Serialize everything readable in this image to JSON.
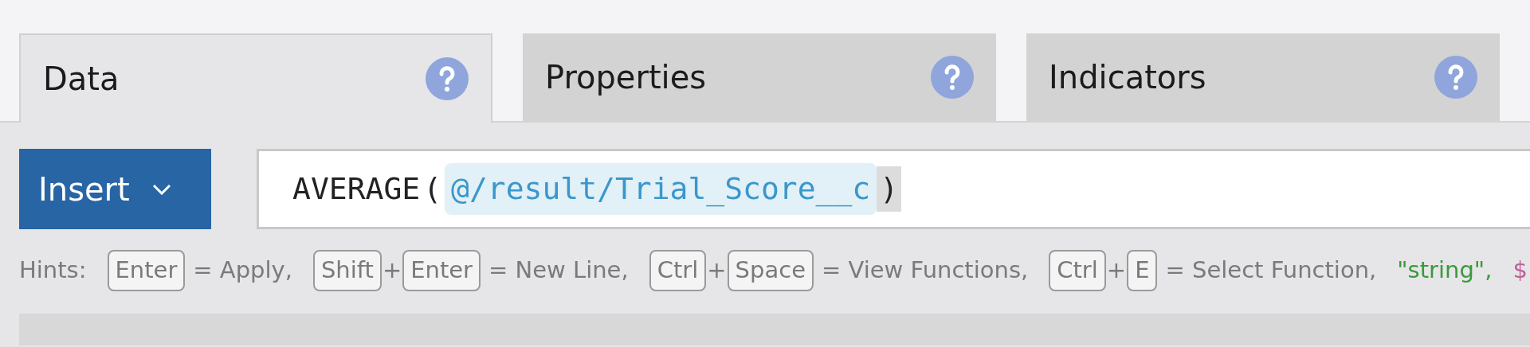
{
  "tabs": [
    {
      "label": "Data",
      "selected": true
    },
    {
      "label": "Properties",
      "selected": false
    },
    {
      "label": "Indicators",
      "selected": false
    }
  ],
  "insert_button": {
    "label": "Insert"
  },
  "expression": [
    {
      "kind": "function",
      "text": "AVERAGE"
    },
    {
      "kind": "paren",
      "text": "("
    },
    {
      "kind": "field",
      "text": "@/result/Trial_Score__c"
    },
    {
      "kind": "paren",
      "text": ")",
      "matched": true
    }
  ],
  "hints": {
    "label": "Hints:",
    "parts": [
      {
        "kind": "key",
        "text": "Enter"
      },
      {
        "kind": "text",
        "text": "= Apply,"
      },
      {
        "kind": "key",
        "text": "Shift"
      },
      {
        "kind": "plus",
        "text": "+"
      },
      {
        "kind": "key",
        "text": "Enter"
      },
      {
        "kind": "text",
        "text": "= New Line,"
      },
      {
        "kind": "key",
        "text": "Ctrl"
      },
      {
        "kind": "plus",
        "text": "+"
      },
      {
        "kind": "key",
        "text": "Space"
      },
      {
        "kind": "text",
        "text": "= View Functions,"
      },
      {
        "kind": "key",
        "text": "Ctrl"
      },
      {
        "kind": "plus",
        "text": "+"
      },
      {
        "kind": "key",
        "text": "E"
      },
      {
        "kind": "text",
        "text": "= Select Function,"
      },
      {
        "kind": "string",
        "text": "\"string\","
      },
      {
        "kind": "symbol",
        "text": "$"
      }
    ]
  }
}
